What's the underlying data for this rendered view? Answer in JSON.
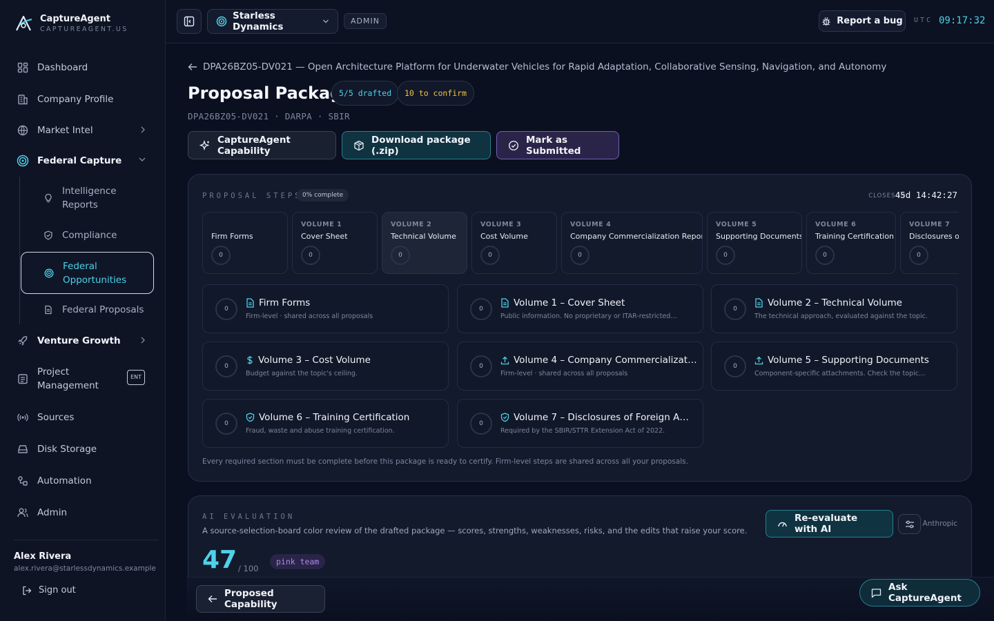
{
  "brand": {
    "name": "CaptureAgent",
    "domain": "CAPTUREAGENT.US"
  },
  "sidebar": {
    "items": [
      {
        "label": "Dashboard",
        "icon": "dashboard-icon"
      },
      {
        "label": "Company Profile",
        "icon": "building-icon"
      },
      {
        "label": "Market Intel",
        "icon": "globe-icon"
      },
      {
        "label": "Federal Capture",
        "icon": "target-icon"
      },
      {
        "label": "Venture Growth",
        "icon": "rocket-icon"
      },
      {
        "label": "Project Management",
        "icon": "clipboard-icon",
        "badge": "ENT"
      },
      {
        "label": "Sources",
        "icon": "broadcast-icon"
      },
      {
        "label": "Disk Storage",
        "icon": "storage-icon"
      },
      {
        "label": "Automation",
        "icon": "automation-icon"
      },
      {
        "label": "Admin",
        "icon": "users-icon"
      }
    ],
    "subitems": [
      {
        "label": "Intelligence Reports",
        "icon": "lightbulb-icon"
      },
      {
        "label": "Compliance",
        "icon": "shield-icon"
      },
      {
        "label": "Federal Opportunities",
        "icon": "target-icon"
      },
      {
        "label": "Federal Proposals",
        "icon": "document-icon"
      }
    ]
  },
  "user": {
    "name": "Alex Rivera",
    "email": "alex.rivera@starlessdynamics.example",
    "signout": "Sign out"
  },
  "topbar": {
    "org": "Starless Dynamics",
    "role": "ADMIN",
    "bug_label": "Report a bug",
    "utc_label": "UTC",
    "clock": "09:17:32"
  },
  "page": {
    "breadcrumb": "DPA26BZ05-DV021 — Open Architecture Platform for Underwater Vehicles for Rapid Adaptation, Collaborative Sensing, Navigation, and Autonomy",
    "title": "Proposal Package",
    "drafted": "5/5 drafted",
    "to_confirm": "10 to confirm",
    "subtitle": "DPA26BZ05-DV021 · DARPA · SBIR",
    "actions": {
      "capability": "CaptureAgent Capability",
      "download": "Download package (.zip)",
      "submitted": "Mark as Submitted"
    }
  },
  "steps": {
    "label": "PROPOSAL STEPS",
    "complete": "0% complete",
    "closes_label": "CLOSES IN",
    "closes_value": "45d 14:42:27",
    "strip": [
      {
        "vol": "",
        "label": "Firm Forms",
        "count": "0"
      },
      {
        "vol": "VOLUME 1",
        "label": "Cover Sheet",
        "count": "0"
      },
      {
        "vol": "VOLUME 2",
        "label": "Technical Volume",
        "count": "0"
      },
      {
        "vol": "VOLUME 3",
        "label": "Cost Volume",
        "count": "0"
      },
      {
        "vol": "VOLUME 4",
        "label": "Company Commercialization Report",
        "count": "0"
      },
      {
        "vol": "VOLUME 5",
        "label": "Supporting Documents",
        "count": "0"
      },
      {
        "vol": "VOLUME 6",
        "label": "Training Certification",
        "count": "0"
      },
      {
        "vol": "VOLUME 7",
        "label": "Disclosures of",
        "count": "0"
      }
    ],
    "cards": [
      {
        "title": "Firm Forms",
        "desc": "Firm-level · shared across all proposals",
        "count": "0",
        "icon": "document-icon"
      },
      {
        "title": "Volume 1 – Cover Sheet",
        "desc": "Public information. No proprietary or ITAR-restricted…",
        "count": "0",
        "icon": "document-icon"
      },
      {
        "title": "Volume 2 – Technical Volume",
        "desc": "The technical approach, evaluated against the topic.",
        "count": "0",
        "icon": "document-icon"
      },
      {
        "title": "Volume 3 – Cost Volume",
        "desc": "Budget against the topic's ceiling.",
        "count": "0",
        "icon": "dollar-icon"
      },
      {
        "title": "Volume 4 – Company Commercializati…",
        "desc": "Firm-level · shared across all proposals",
        "count": "0",
        "icon": "upload-icon"
      },
      {
        "title": "Volume 5 – Supporting Documents",
        "desc": "Component-specific attachments. Check the topic…",
        "count": "0",
        "icon": "upload-icon"
      },
      {
        "title": "Volume 6 – Training Certification",
        "desc": "Fraud, waste and abuse training certification.",
        "count": "0",
        "icon": "shield-check-icon"
      },
      {
        "title": "Volume 7 – Disclosures of Foreign Affil…",
        "desc": "Required by the SBIR/STTR Extension Act of 2022.",
        "count": "0",
        "icon": "shield-check-icon"
      }
    ],
    "footer": "Every required section must be complete before this package is ready to certify. Firm-level steps are shared across all your proposals."
  },
  "ai": {
    "label": "AI EVALUATION",
    "desc": "A source-selection-board color review of the drafted package — scores, strengths, weaknesses, risks, and the edits that raise your score.",
    "score": "47",
    "score_max": "/ 100",
    "team": "pink team",
    "reeval": "Re-evaluate with AI",
    "provider": "Anthropic"
  },
  "footer": {
    "back": "Proposed Capability",
    "ask": "Ask CaptureAgent"
  },
  "colors": {
    "accent": "#4fd1e8",
    "warn": "#f5c24a",
    "purple": "#6f62b8",
    "bg": "#0b1020"
  }
}
